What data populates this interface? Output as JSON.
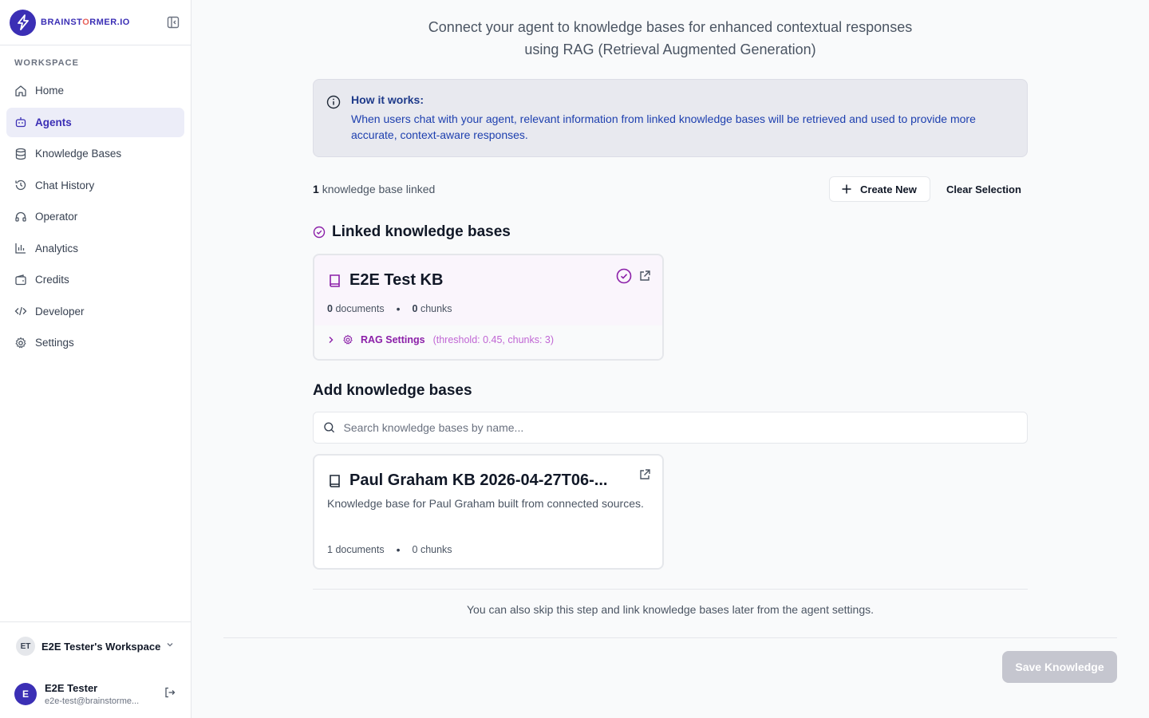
{
  "brand": {
    "name_part1": "BRAINST",
    "name_accent": "O",
    "name_part2": "RMER.IO"
  },
  "sidebar": {
    "section_label": "WORKSPACE",
    "items": [
      {
        "label": "Home",
        "icon": "home-icon"
      },
      {
        "label": "Agents",
        "icon": "bot-icon",
        "active": true
      },
      {
        "label": "Knowledge Bases",
        "icon": "database-icon"
      },
      {
        "label": "Chat History",
        "icon": "history-icon"
      },
      {
        "label": "Operator",
        "icon": "headset-icon"
      },
      {
        "label": "Analytics",
        "icon": "bar-chart-icon"
      },
      {
        "label": "Credits",
        "icon": "wallet-icon"
      },
      {
        "label": "Developer",
        "icon": "code-icon"
      },
      {
        "label": "Settings",
        "icon": "gear-icon"
      }
    ],
    "workspace": {
      "initials": "ET",
      "name": "E2E Tester's Workspace"
    },
    "user": {
      "initial": "E",
      "name": "E2E Tester",
      "email": "e2e-test@brainstorme..."
    }
  },
  "main": {
    "subtitle_line1": "Connect your agent to knowledge bases for enhanced contextual responses",
    "subtitle_line2": "using RAG (Retrieval Augmented Generation)",
    "info": {
      "title": "How it works:",
      "text": "When users chat with your agent, relevant information from linked knowledge bases will be retrieved and used to provide more accurate, context-aware responses."
    },
    "linked_count": "1",
    "linked_count_suffix": "knowledge base linked",
    "create_new_label": "Create New",
    "clear_selection_label": "Clear Selection",
    "linked_heading": "Linked knowledge bases",
    "linked_kb": {
      "title": "E2E Test KB",
      "documents_count": "0",
      "documents_label": "documents",
      "chunks_count": "0",
      "chunks_label": "chunks",
      "rag_label": "RAG Settings",
      "rag_params": "(threshold: 0.45, chunks: 3)"
    },
    "add_heading": "Add knowledge bases",
    "search_placeholder": "Search knowledge bases by name...",
    "available_kbs": [
      {
        "title": "Paul Graham KB 2026-04-27T06-...",
        "description": "Knowledge base for Paul Graham built from connected sources.",
        "documents_count": "1",
        "documents_label": "documents",
        "chunks_count": "0",
        "chunks_label": "chunks"
      }
    ],
    "skip_note": "You can also skip this step and link knowledge bases later from the agent settings.",
    "save_label": "Save Knowledge"
  },
  "colors": {
    "brand": "#3b2fb5",
    "accent": "#8b1fa8",
    "info_text": "#1e40af"
  }
}
